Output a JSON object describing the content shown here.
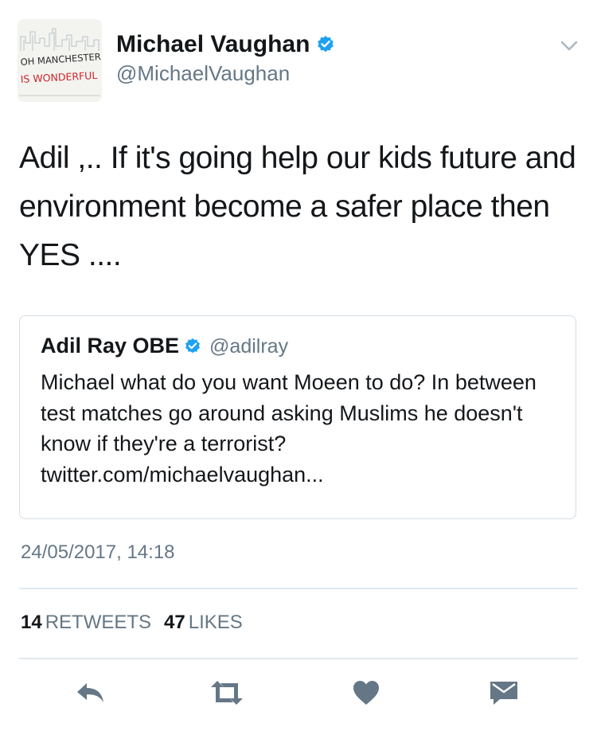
{
  "author": {
    "name": "Michael Vaughan",
    "handle": "@MichaelVaughan",
    "avatar_text_line1": "OH MANCHESTER",
    "avatar_text_line2": "IS WONDERFUL"
  },
  "tweet": {
    "text": "Adil ,.. If it's going help our kids future and environment become a safer place then YES ....",
    "timestamp": "24/05/2017, 14:18"
  },
  "quoted_tweet": {
    "name": "Adil Ray OBE",
    "handle": "@adilray",
    "text": "Michael what do you want Moeen to do? In between test matches go around asking Muslims he doesn't know if they're a terrorist? twitter.com/michaelvaughan..."
  },
  "stats": {
    "retweets_count": "14",
    "retweets_label": "RETWEETS",
    "likes_count": "47",
    "likes_label": "LIKES"
  },
  "colors": {
    "verified_blue": "#1da1f2",
    "secondary_text": "#657786",
    "icon_gray": "#657786",
    "divider": "#e1e8ed"
  },
  "icons": [
    "verified-icon",
    "caret-down-icon",
    "reply-icon",
    "retweet-icon",
    "like-icon",
    "message-icon"
  ]
}
